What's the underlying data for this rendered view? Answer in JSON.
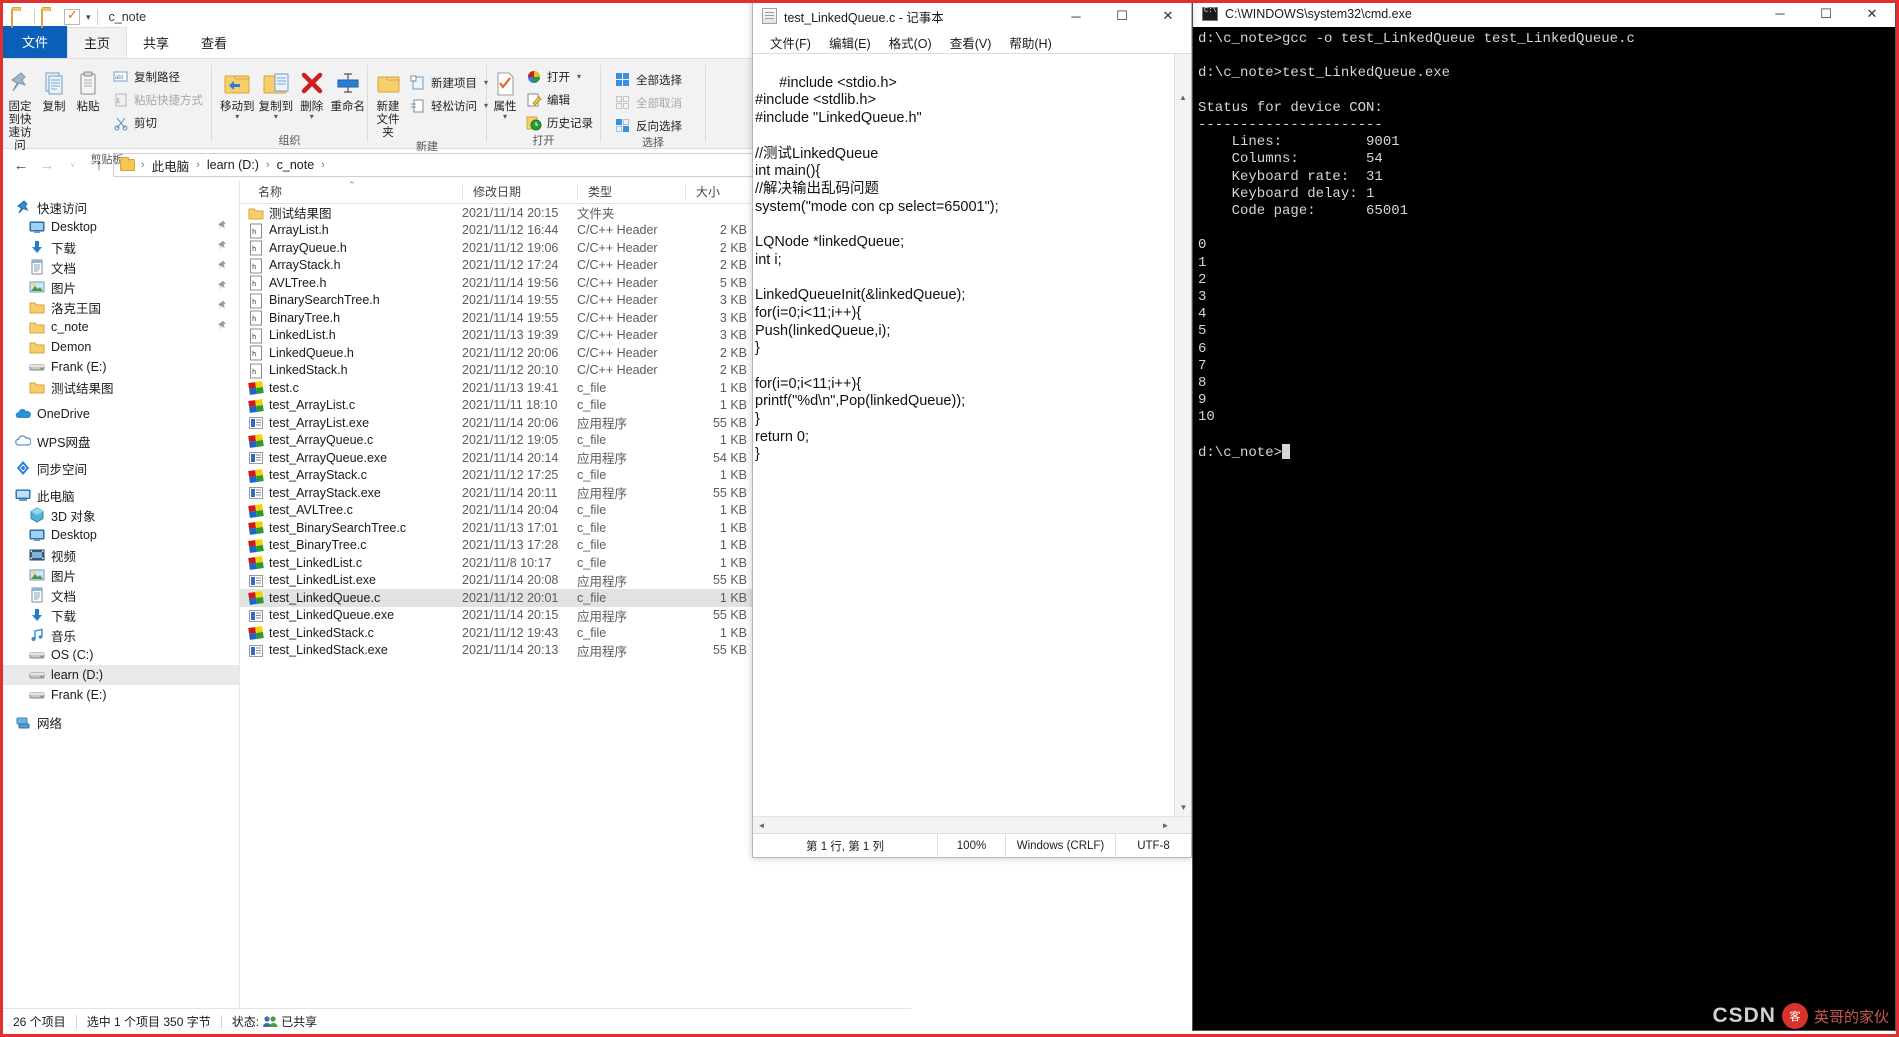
{
  "explorer": {
    "title": "c_note",
    "quick_access_icons": [
      "folder-icon",
      "folder-icon",
      "check-icon",
      "chevron-down-icon"
    ],
    "tabs": [
      {
        "id": "file",
        "label": "文件"
      },
      {
        "id": "home",
        "label": "主页"
      },
      {
        "id": "share",
        "label": "共享"
      },
      {
        "id": "view",
        "label": "查看"
      }
    ],
    "ribbon_groups": [
      {
        "name": "clipboard",
        "label": "剪贴板",
        "big": [
          {
            "label_line1": "固定到快",
            "label_line2": "速访问",
            "icon": "pin-icon"
          },
          {
            "label_line1": "复制",
            "label_line2": "",
            "icon": "copy-icon"
          },
          {
            "label_line1": "粘贴",
            "label_line2": "",
            "icon": "paste-icon"
          }
        ],
        "small": [
          {
            "label": "复制路径",
            "icon": "copy-path-icon",
            "dimmed": false
          },
          {
            "label": "粘贴快捷方式",
            "icon": "paste-shortcut-icon",
            "dimmed": true
          },
          {
            "label": "剪切",
            "icon": "scissors-icon",
            "dimmed": false
          }
        ]
      },
      {
        "name": "organize",
        "label": "组织",
        "big": [
          {
            "label_line1": "移动到",
            "label_line2": "",
            "icon": "move-to-icon",
            "dropdown": true
          },
          {
            "label_line1": "复制到",
            "label_line2": "",
            "icon": "copy-to-icon",
            "dropdown": true
          },
          {
            "label_line1": "删除",
            "label_line2": "",
            "icon": "delete-icon",
            "dropdown": true
          },
          {
            "label_line1": "重命名",
            "label_line2": "",
            "icon": "rename-icon"
          }
        ]
      },
      {
        "name": "new",
        "label": "新建",
        "big": [
          {
            "label_line1": "新建",
            "label_line2": "文件夹",
            "icon": "new-folder-icon"
          }
        ],
        "small": [
          {
            "label": "新建项目",
            "icon": "new-item-icon",
            "dropdown": true
          },
          {
            "label": "轻松访问",
            "icon": "easy-access-icon",
            "dropdown": true
          }
        ]
      },
      {
        "name": "open",
        "label": "打开",
        "big": [
          {
            "label_line1": "属性",
            "label_line2": "",
            "icon": "properties-icon",
            "dropdown": true
          }
        ],
        "small": [
          {
            "label": "打开",
            "icon": "open-icon",
            "dropdown": true
          },
          {
            "label": "编辑",
            "icon": "edit-icon"
          },
          {
            "label": "历史记录",
            "icon": "history-icon"
          }
        ]
      },
      {
        "name": "select",
        "label": "选择",
        "small": [
          {
            "label": "全部选择",
            "icon": "select-all-icon"
          },
          {
            "label": "全部取消",
            "icon": "select-none-icon",
            "dimmed": true
          },
          {
            "label": "反向选择",
            "icon": "invert-selection-icon"
          }
        ]
      }
    ],
    "nav": {
      "back": "←",
      "forward": "→",
      "recent": "˅",
      "up": "↑"
    },
    "breadcrumbs": [
      "此电脑",
      "learn (D:)",
      "c_note"
    ],
    "nav_pane": [
      {
        "label": "快速访问",
        "icon": "star-pin-icon",
        "level": 0,
        "group": true
      },
      {
        "label": "Desktop",
        "icon": "desktop-icon",
        "level": 1,
        "pinned": true
      },
      {
        "label": "下载",
        "icon": "download-icon",
        "level": 1,
        "pinned": true
      },
      {
        "label": "文档",
        "icon": "documents-icon",
        "level": 1,
        "pinned": true
      },
      {
        "label": "图片",
        "icon": "pictures-icon",
        "level": 1,
        "pinned": true
      },
      {
        "label": "洛克王国",
        "icon": "folder-icon",
        "level": 1,
        "pinned": true
      },
      {
        "label": "c_note",
        "icon": "folder-icon",
        "level": 1,
        "pinned": true
      },
      {
        "label": "Demon",
        "icon": "folder-icon",
        "level": 1
      },
      {
        "label": "Frank (E:)",
        "icon": "drive-icon",
        "level": 1
      },
      {
        "label": "测试结果图",
        "icon": "folder-icon",
        "level": 1
      },
      {
        "label": "OneDrive",
        "icon": "onedrive-icon",
        "level": 0,
        "group": true
      },
      {
        "label": "WPS网盘",
        "icon": "wps-cloud-icon",
        "level": 0,
        "group": true
      },
      {
        "label": "同步空间",
        "icon": "sync-icon",
        "level": 0,
        "group": true
      },
      {
        "label": "此电脑",
        "icon": "this-pc-icon",
        "level": 0,
        "group": true
      },
      {
        "label": "3D 对象",
        "icon": "3d-objects-icon",
        "level": 1
      },
      {
        "label": "Desktop",
        "icon": "desktop-icon",
        "level": 1
      },
      {
        "label": "视频",
        "icon": "videos-icon",
        "level": 1
      },
      {
        "label": "图片",
        "icon": "pictures-icon",
        "level": 1
      },
      {
        "label": "文档",
        "icon": "documents-icon",
        "level": 1
      },
      {
        "label": "下载",
        "icon": "download-icon",
        "level": 1
      },
      {
        "label": "音乐",
        "icon": "music-icon",
        "level": 1
      },
      {
        "label": "OS (C:)",
        "icon": "drive-icon",
        "level": 1
      },
      {
        "label": "learn (D:)",
        "icon": "drive-icon",
        "level": 1,
        "selected": true
      },
      {
        "label": "Frank (E:)",
        "icon": "drive-icon",
        "level": 1
      },
      {
        "label": "网络",
        "icon": "network-icon",
        "level": 0,
        "group": true
      }
    ],
    "columns": [
      "名称",
      "修改日期",
      "类型",
      "大小"
    ],
    "sort_column": "名称",
    "files": [
      {
        "name": "测试结果图",
        "date": "2021/11/14 20:15",
        "type": "文件夹",
        "size": "",
        "icon": "folder-icon"
      },
      {
        "name": "ArrayList.h",
        "date": "2021/11/12 16:44",
        "type": "C/C++ Header",
        "size": "2 KB",
        "icon": "header-file-icon"
      },
      {
        "name": "ArrayQueue.h",
        "date": "2021/11/12 19:06",
        "type": "C/C++ Header",
        "size": "2 KB",
        "icon": "header-file-icon"
      },
      {
        "name": "ArrayStack.h",
        "date": "2021/11/12 17:24",
        "type": "C/C++ Header",
        "size": "2 KB",
        "icon": "header-file-icon"
      },
      {
        "name": "AVLTree.h",
        "date": "2021/11/14 19:56",
        "type": "C/C++ Header",
        "size": "5 KB",
        "icon": "header-file-icon"
      },
      {
        "name": "BinarySearchTree.h",
        "date": "2021/11/14 19:55",
        "type": "C/C++ Header",
        "size": "3 KB",
        "icon": "header-file-icon"
      },
      {
        "name": "BinaryTree.h",
        "date": "2021/11/14 19:55",
        "type": "C/C++ Header",
        "size": "3 KB",
        "icon": "header-file-icon"
      },
      {
        "name": "LinkedList.h",
        "date": "2021/11/13 19:39",
        "type": "C/C++ Header",
        "size": "3 KB",
        "icon": "header-file-icon"
      },
      {
        "name": "LinkedQueue.h",
        "date": "2021/11/12 20:06",
        "type": "C/C++ Header",
        "size": "2 KB",
        "icon": "header-file-icon"
      },
      {
        "name": "LinkedStack.h",
        "date": "2021/11/12 20:10",
        "type": "C/C++ Header",
        "size": "2 KB",
        "icon": "header-file-icon"
      },
      {
        "name": "test.c",
        "date": "2021/11/13 19:41",
        "type": "c_file",
        "size": "1 KB",
        "icon": "c-file-icon"
      },
      {
        "name": "test_ArrayList.c",
        "date": "2021/11/11 18:10",
        "type": "c_file",
        "size": "1 KB",
        "icon": "c-file-icon"
      },
      {
        "name": "test_ArrayList.exe",
        "date": "2021/11/14 20:06",
        "type": "应用程序",
        "size": "55 KB",
        "icon": "exe-file-icon"
      },
      {
        "name": "test_ArrayQueue.c",
        "date": "2021/11/12 19:05",
        "type": "c_file",
        "size": "1 KB",
        "icon": "c-file-icon"
      },
      {
        "name": "test_ArrayQueue.exe",
        "date": "2021/11/14 20:14",
        "type": "应用程序",
        "size": "54 KB",
        "icon": "exe-file-icon"
      },
      {
        "name": "test_ArrayStack.c",
        "date": "2021/11/12 17:25",
        "type": "c_file",
        "size": "1 KB",
        "icon": "c-file-icon"
      },
      {
        "name": "test_ArrayStack.exe",
        "date": "2021/11/14 20:11",
        "type": "应用程序",
        "size": "55 KB",
        "icon": "exe-file-icon"
      },
      {
        "name": "test_AVLTree.c",
        "date": "2021/11/14 20:04",
        "type": "c_file",
        "size": "1 KB",
        "icon": "c-file-icon"
      },
      {
        "name": "test_BinarySearchTree.c",
        "date": "2021/11/13 17:01",
        "type": "c_file",
        "size": "1 KB",
        "icon": "c-file-icon"
      },
      {
        "name": "test_BinaryTree.c",
        "date": "2021/11/13 17:28",
        "type": "c_file",
        "size": "1 KB",
        "icon": "c-file-icon"
      },
      {
        "name": "test_LinkedList.c",
        "date": "2021/11/8 10:17",
        "type": "c_file",
        "size": "1 KB",
        "icon": "c-file-icon"
      },
      {
        "name": "test_LinkedList.exe",
        "date": "2021/11/14 20:08",
        "type": "应用程序",
        "size": "55 KB",
        "icon": "exe-file-icon"
      },
      {
        "name": "test_LinkedQueue.c",
        "date": "2021/11/12 20:01",
        "type": "c_file",
        "size": "1 KB",
        "icon": "c-file-icon",
        "selected": true
      },
      {
        "name": "test_LinkedQueue.exe",
        "date": "2021/11/14 20:15",
        "type": "应用程序",
        "size": "55 KB",
        "icon": "exe-file-icon"
      },
      {
        "name": "test_LinkedStack.c",
        "date": "2021/11/12 19:43",
        "type": "c_file",
        "size": "1 KB",
        "icon": "c-file-icon"
      },
      {
        "name": "test_LinkedStack.exe",
        "date": "2021/11/14 20:13",
        "type": "应用程序",
        "size": "55 KB",
        "icon": "exe-file-icon"
      }
    ],
    "status": {
      "item_count": "26 个项目",
      "selection": "选中 1 个项目  350 字节",
      "share_state": "状态:",
      "share_label": "已共享"
    }
  },
  "notepad": {
    "title": "test_LinkedQueue.c - 记事本",
    "menu": [
      "文件(F)",
      "编辑(E)",
      "格式(O)",
      "查看(V)",
      "帮助(H)"
    ],
    "window_buttons": [
      "minimize",
      "maximize",
      "close"
    ],
    "content": "#include <stdio.h>\n#include <stdlib.h>\n#include \"LinkedQueue.h\"\n\n//测试LinkedQueue\nint main(){\n//解决输出乱码问题\nsystem(\"mode con cp select=65001\");\n\nLQNode *linkedQueue;\nint i;\n\nLinkedQueueInit(&linkedQueue);\nfor(i=0;i<11;i++){\nPush(linkedQueue,i);\n}\n\nfor(i=0;i<11;i++){\nprintf(\"%d\\n\",Pop(linkedQueue));\n}\nreturn 0;\n}",
    "status": {
      "position": "第 1 行, 第 1 列",
      "zoom": "100%",
      "line_ending": "Windows (CRLF)",
      "encoding": "UTF-8"
    }
  },
  "cmd": {
    "title": "C:\\WINDOWS\\system32\\cmd.exe",
    "window_buttons": [
      "minimize",
      "maximize",
      "close"
    ],
    "content": "d:\\c_note>gcc -o test_LinkedQueue test_LinkedQueue.c\n\nd:\\c_note>test_LinkedQueue.exe\n\nStatus for device CON:\n----------------------\n    Lines:          9001\n    Columns:        54\n    Keyboard rate:  31\n    Keyboard delay: 1\n    Code page:      65001\n\n0\n1\n2\n3\n4\n5\n6\n7\n8\n9\n10\n\nd:\\c_note>"
  },
  "watermark": {
    "brand": "CSDN",
    "badge": "客",
    "text": "英哥的家伙"
  }
}
